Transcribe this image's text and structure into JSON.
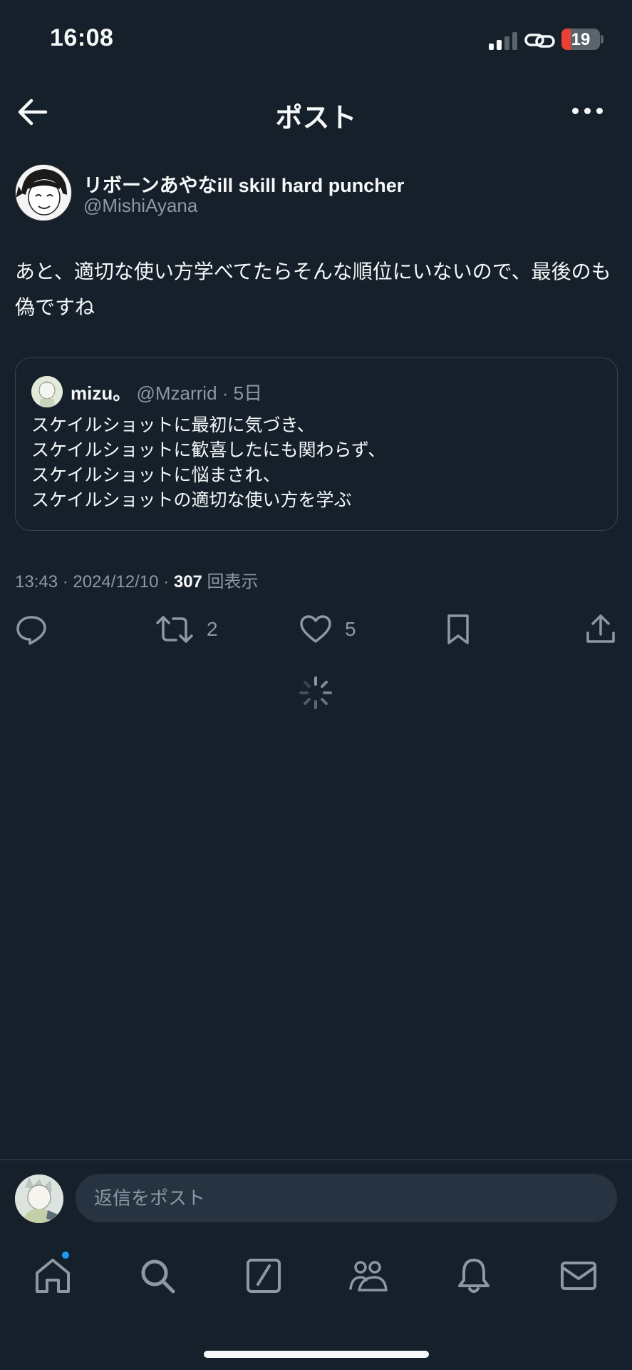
{
  "status_bar": {
    "time": "16:08",
    "battery": "19"
  },
  "header": {
    "title": "ポスト"
  },
  "post": {
    "author_name": "リボーンあやなill skill hard puncher",
    "author_handle": "@MishiAyana",
    "text": "あと、適切な使い方学べてたらそんな順位にいないので、最後のも偽ですね",
    "timestamp": "13:43 · 2024/12/10 · ",
    "views_count": "307",
    "views_label": " 回表示"
  },
  "quoted_post": {
    "name": "mizu。",
    "meta": " @Mzarrid · 5日",
    "lines": [
      "スケイルショットに最初に気づき、",
      "スケイルショットに歓喜したにも関わらず、",
      "スケイルショットに悩まされ、",
      "スケイルショットの適切な使い方を学ぶ"
    ]
  },
  "actions": {
    "reply_icon": "reply-icon",
    "retweet_count": "2",
    "like_count": "5",
    "bookmark_icon": "bookmark-icon",
    "share_icon": "share-icon"
  },
  "reply_bar": {
    "placeholder": "返信をポスト"
  },
  "nav": [
    "home-icon",
    "search-icon",
    "grok-icon",
    "communities-icon",
    "notifications-icon",
    "messages-icon"
  ],
  "colors": {
    "background": "#15202b",
    "text": "#f7f9f9",
    "secondary": "#8b98a5",
    "border": "#38444d",
    "accent": "#1d9bf0",
    "battery_low": "#eb4034"
  }
}
